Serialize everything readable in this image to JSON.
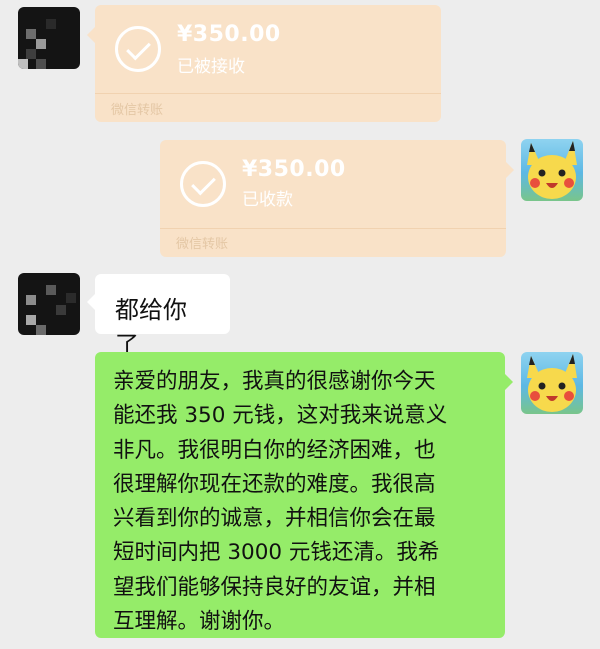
{
  "colors": {
    "background": "#ededed",
    "transfer_card": "#f9e2c8",
    "sent_bubble": "#95ec69",
    "received_bubble": "#ffffff"
  },
  "messages": [
    {
      "type": "transfer",
      "side": "left",
      "avatar": "pixelated-avatar",
      "icon": "check-circle-icon",
      "amount": "¥350.00",
      "status": "已被接收",
      "footer": "微信转账"
    },
    {
      "type": "transfer",
      "side": "right",
      "avatar": "pikachu-avatar",
      "icon": "check-circle-icon",
      "amount": "¥350.00",
      "status": "已收款",
      "footer": "微信转账"
    },
    {
      "type": "text",
      "side": "left",
      "avatar": "pixelated-avatar",
      "text": "都给你了"
    },
    {
      "type": "text",
      "side": "right",
      "avatar": "pikachu-avatar",
      "lines": [
        "亲爱的朋友，我真的很感谢你今天",
        "能还我 350 元钱，这对我来说意义",
        "非凡。我很明白你的经济困难，也",
        "很理解你现在还款的难度。我很高",
        "兴看到你的诚意，并相信你会在最",
        "短时间内把 3000 元钱还清。我希",
        "望我们能够保持良好的友谊，并相",
        "互理解。谢谢你。"
      ]
    }
  ]
}
